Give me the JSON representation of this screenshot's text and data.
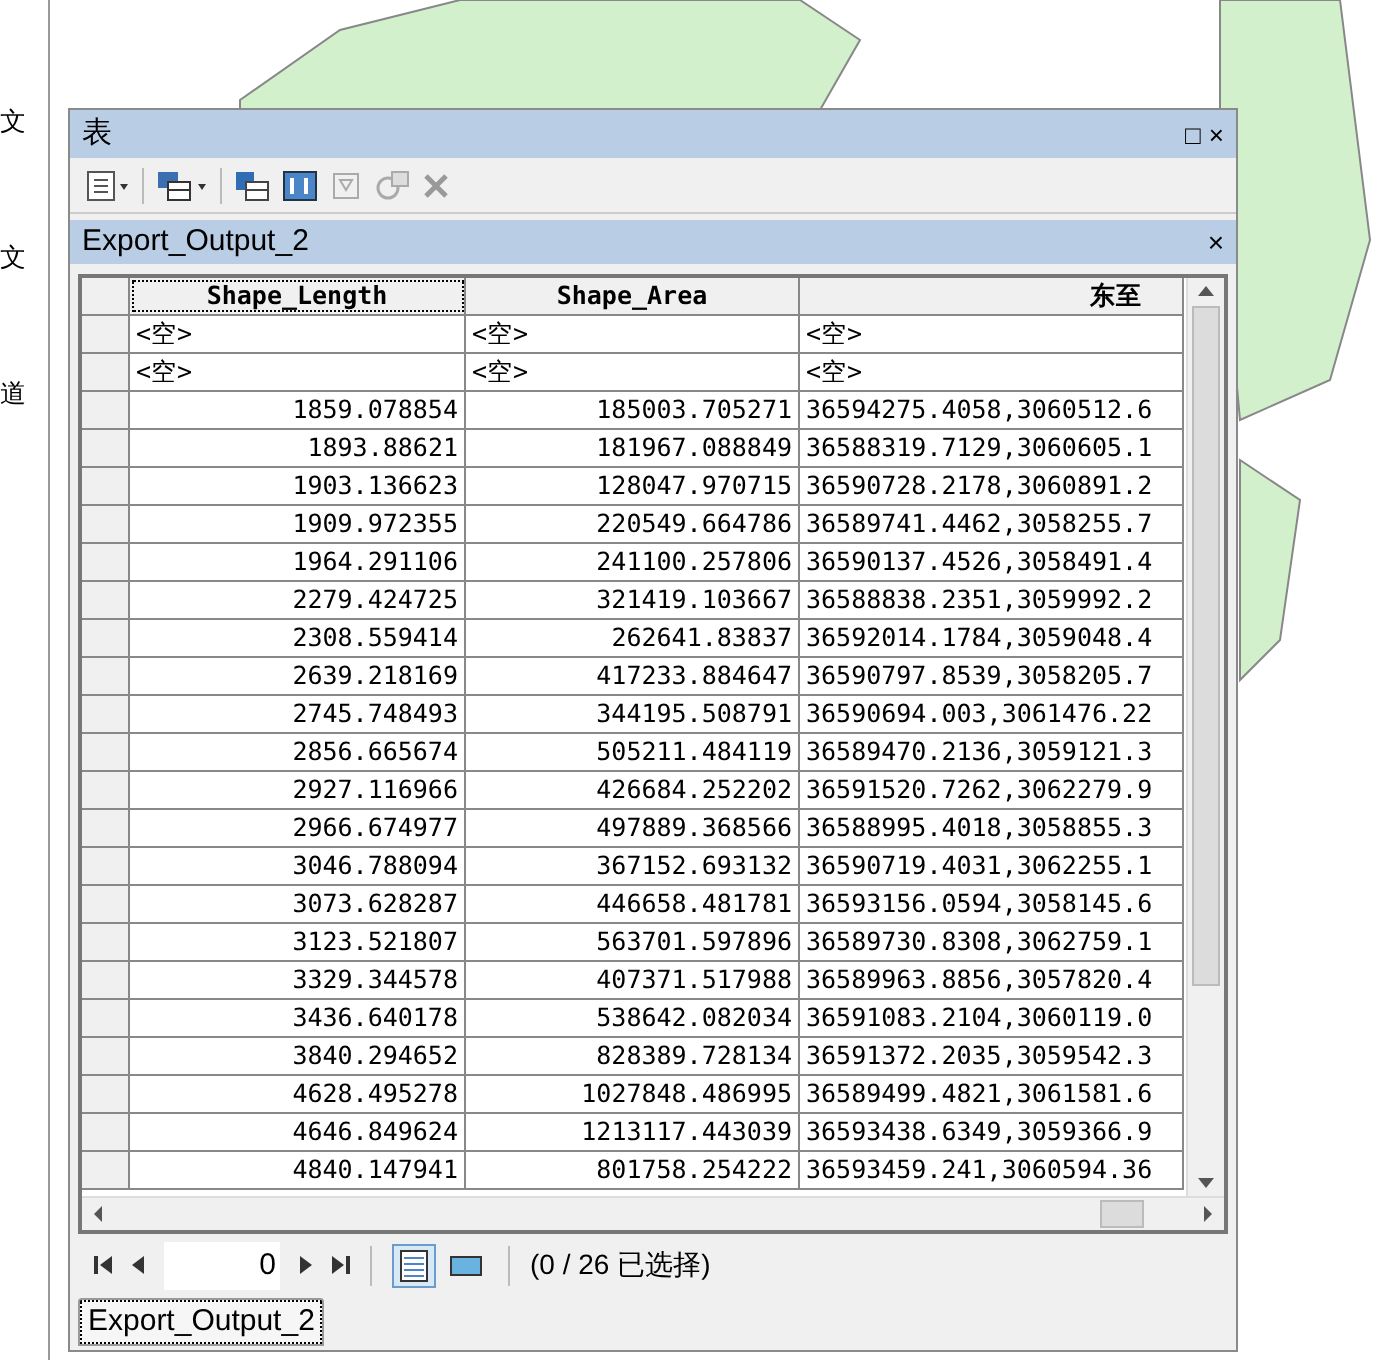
{
  "side_labels": [
    "文",
    "文",
    "道"
  ],
  "window": {
    "title": "表",
    "controls": [
      "□",
      "×"
    ]
  },
  "table_tab": {
    "title": "Export_Output_2",
    "close": "×"
  },
  "table": {
    "columns": [
      "Shape_Length",
      "Shape_Area",
      "东至"
    ],
    "rows": [
      [
        "<空>",
        "<空>",
        "<空>"
      ],
      [
        "<空>",
        "<空>",
        "<空>"
      ],
      [
        "1859.078854",
        "185003.705271",
        "36594275.4058,3060512.6"
      ],
      [
        "1893.88621",
        "181967.088849",
        "36588319.7129,3060605.1"
      ],
      [
        "1903.136623",
        "128047.970715",
        "36590728.2178,3060891.2"
      ],
      [
        "1909.972355",
        "220549.664786",
        "36589741.4462,3058255.7"
      ],
      [
        "1964.291106",
        "241100.257806",
        "36590137.4526,3058491.4"
      ],
      [
        "2279.424725",
        "321419.103667",
        "36588838.2351,3059992.2"
      ],
      [
        "2308.559414",
        "262641.83837",
        "36592014.1784,3059048.4"
      ],
      [
        "2639.218169",
        "417233.884647",
        "36590797.8539,3058205.7"
      ],
      [
        "2745.748493",
        "344195.508791",
        "36590694.003,3061476.22"
      ],
      [
        "2856.665674",
        "505211.484119",
        "36589470.2136,3059121.3"
      ],
      [
        "2927.116966",
        "426684.252202",
        "36591520.7262,3062279.9"
      ],
      [
        "2966.674977",
        "497889.368566",
        "36588995.4018,3058855.3"
      ],
      [
        "3046.788094",
        "367152.693132",
        "36590719.4031,3062255.1"
      ],
      [
        "3073.628287",
        "446658.481781",
        "36593156.0594,3058145.6"
      ],
      [
        "3123.521807",
        "563701.597896",
        "36589730.8308,3062759.1"
      ],
      [
        "3329.344578",
        "407371.517988",
        "36589963.8856,3057820.4"
      ],
      [
        "3436.640178",
        "538642.082034",
        "36591083.2104,3060119.0"
      ],
      [
        "3840.294652",
        "828389.728134",
        "36591372.2035,3059542.3"
      ],
      [
        "4628.495278",
        "1027848.486995",
        "36589499.4821,3061581.6"
      ],
      [
        "4646.849624",
        "1213117.443039",
        "36593438.6349,3059366.9"
      ],
      [
        "4840.147941",
        "801758.254222",
        "36593459.241,3060594.36"
      ]
    ]
  },
  "navigator": {
    "record": "0",
    "view_buttons": [
      {
        "selected": true
      },
      {
        "selected": false
      }
    ],
    "selection": "(0 / 26 已选择)"
  },
  "bottom_tab": {
    "label": "Export_Output_2",
    "selected": true
  }
}
